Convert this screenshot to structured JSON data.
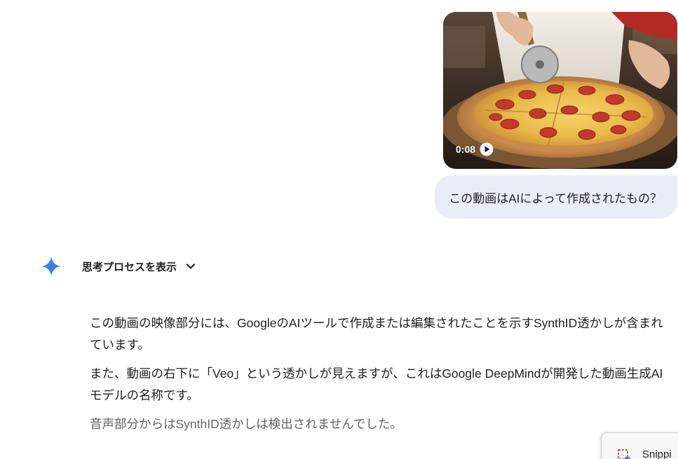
{
  "video": {
    "duration": "0:08",
    "play_icon": "play-circle-icon"
  },
  "user_message": {
    "text": "この動画はAIによって作成されたもの？"
  },
  "response": {
    "icon": "gemini-sparkle-icon",
    "thinking_toggle_label": "思考プロセスを表示",
    "paragraphs": [
      "この動画の映像部分には、GoogleのAIツールで作成または編集されたことを示すSynthID透かしが含まれています。",
      "また、動画の右下に「Veo」という透かしが見えますが、これはGoogle DeepMindが開発した動画生成AIモデルの名称です。",
      "音声部分からはSynthID透かしは検出されませんでした。"
    ]
  },
  "snipping_tool": {
    "label": "Snippi",
    "icon": "snipping-tool-icon"
  },
  "colors": {
    "bubble_bg": "#e9eef6",
    "accent_blue": "#4285f4",
    "text": "#1f1f1f",
    "muted_text": "#5f6368"
  }
}
